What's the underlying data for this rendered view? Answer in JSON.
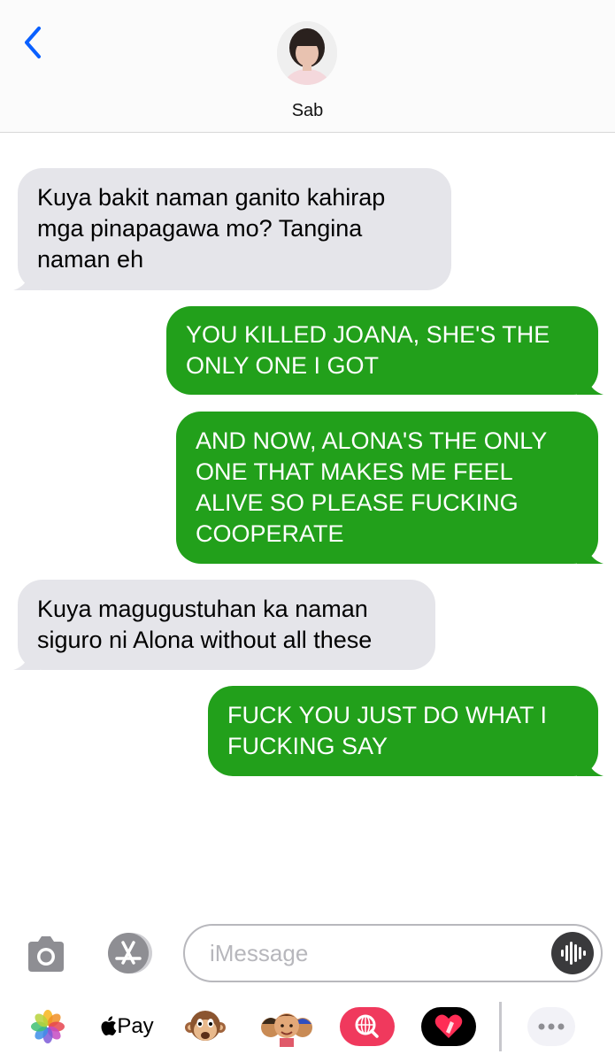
{
  "header": {
    "contact_name": "Sab"
  },
  "messages": [
    {
      "direction": "incoming",
      "text_lines": [
        "Kuya bakit naman ganito kahirap",
        "mga pinapagawa mo? Tangina",
        "naman eh"
      ]
    },
    {
      "direction": "outgoing",
      "text_lines": [
        "YOU KILLED JOANA, SHE'S THE",
        "ONLY ONE I GOT"
      ]
    },
    {
      "direction": "outgoing",
      "text_lines": [
        "AND NOW, ALONA'S THE ONLY",
        "ONE THAT MAKES ME FEEL",
        "ALIVE SO PLEASE FUCKING",
        "COOPERATE"
      ]
    },
    {
      "direction": "incoming",
      "text_lines": [
        "Kuya magugustuhan ka naman",
        "siguro ni Alona without all these"
      ]
    },
    {
      "direction": "outgoing",
      "text_lines": [
        "FUCK YOU JUST DO WHAT I",
        "FUCKING SAY"
      ]
    }
  ],
  "composer": {
    "placeholder": "iMessage"
  },
  "app_drawer": {
    "apple_pay_label": "Pay",
    "icons": [
      "photos-icon",
      "apple-pay-icon",
      "monkey-emoji-icon",
      "memoji-icon",
      "web-search-icon",
      "digital-touch-icon",
      "more-icon"
    ]
  },
  "colors": {
    "outgoing_bubble": "#22a01b",
    "incoming_bubble": "#e5e5ea",
    "accent_blue": "#0a60ff"
  }
}
